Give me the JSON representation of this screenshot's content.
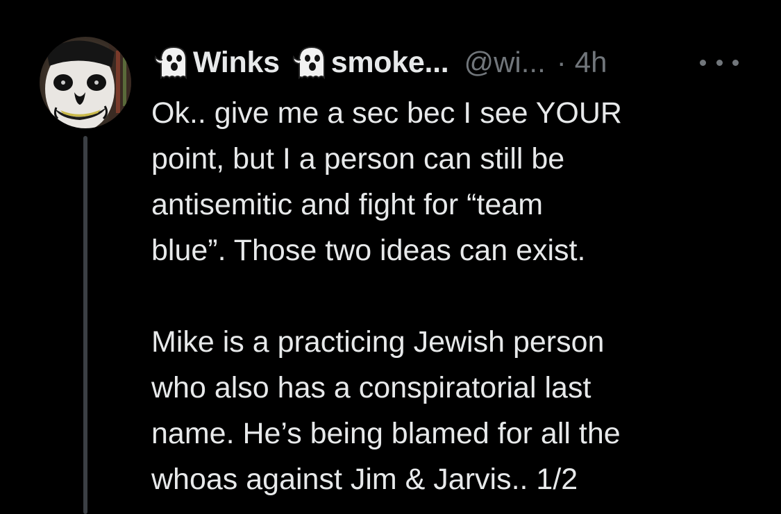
{
  "tweet": {
    "author": {
      "name_prefix_icon": "ghost-icon",
      "name_first": "Winks",
      "name_mid_icon": "ghost-icon",
      "name_second": "smoke...",
      "handle": "@wi...",
      "separator": "·",
      "time": "4h",
      "more_icon": "more-horizontal-icon"
    },
    "text": {
      "lines": [
        "Ok.. give me a sec bec I see YOUR",
        "point, but I a person can still be",
        "antisemitic and fight for “team",
        "blue”.  Those two ideas can exist.",
        "",
        "Mike is a practicing Jewish person",
        "who also has a conspiratorial last",
        "name.  He’s being blamed for all the",
        "whoas against Jim & Jarvis.. 1/2"
      ]
    }
  },
  "colors": {
    "background": "#000000",
    "text_primary": "#e7e9ea",
    "text_secondary": "#71767b",
    "thread_line": "#3b3f44"
  }
}
